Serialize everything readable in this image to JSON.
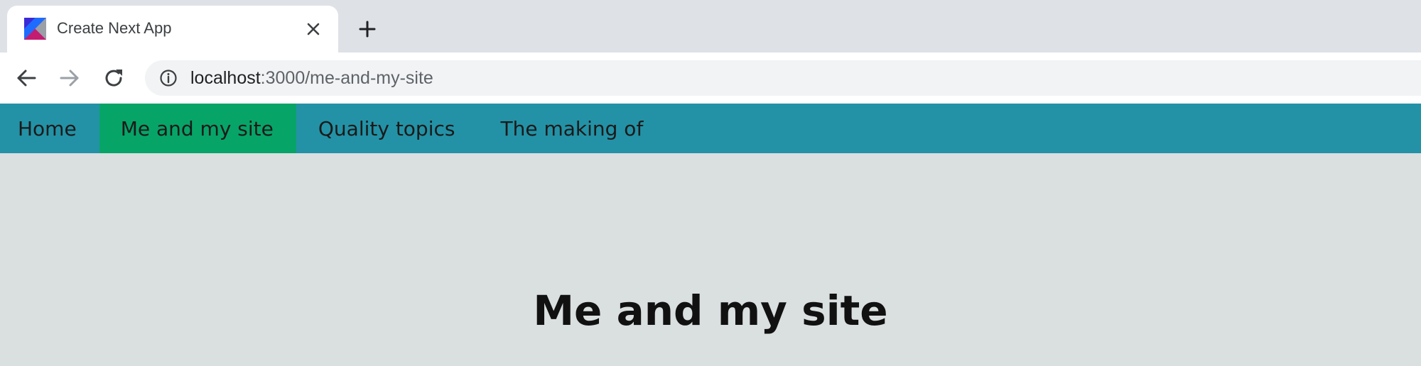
{
  "browser": {
    "tab": {
      "title": "Create Next App",
      "favicon_icon": "kotlin-logo-icon",
      "close_icon": "close-icon"
    },
    "new_tab_icon": "plus-icon",
    "toolbar": {
      "back_icon": "arrow-left-icon",
      "forward_icon": "arrow-right-icon",
      "reload_icon": "reload-icon"
    },
    "address_bar": {
      "info_icon": "info-icon",
      "host": "localhost",
      "rest": ":3000/me-and-my-site"
    }
  },
  "site_nav": {
    "items": [
      {
        "label": "Home",
        "active": false
      },
      {
        "label": "Me and my site",
        "active": true
      },
      {
        "label": "Quality topics",
        "active": false
      },
      {
        "label": "The making of",
        "active": false
      }
    ]
  },
  "main": {
    "title": "Me and my site"
  },
  "colors": {
    "nav_background": "#2392a6",
    "nav_active": "#07a468",
    "page_background": "#dadfe0",
    "tabstrip_background": "#dee1e6"
  }
}
